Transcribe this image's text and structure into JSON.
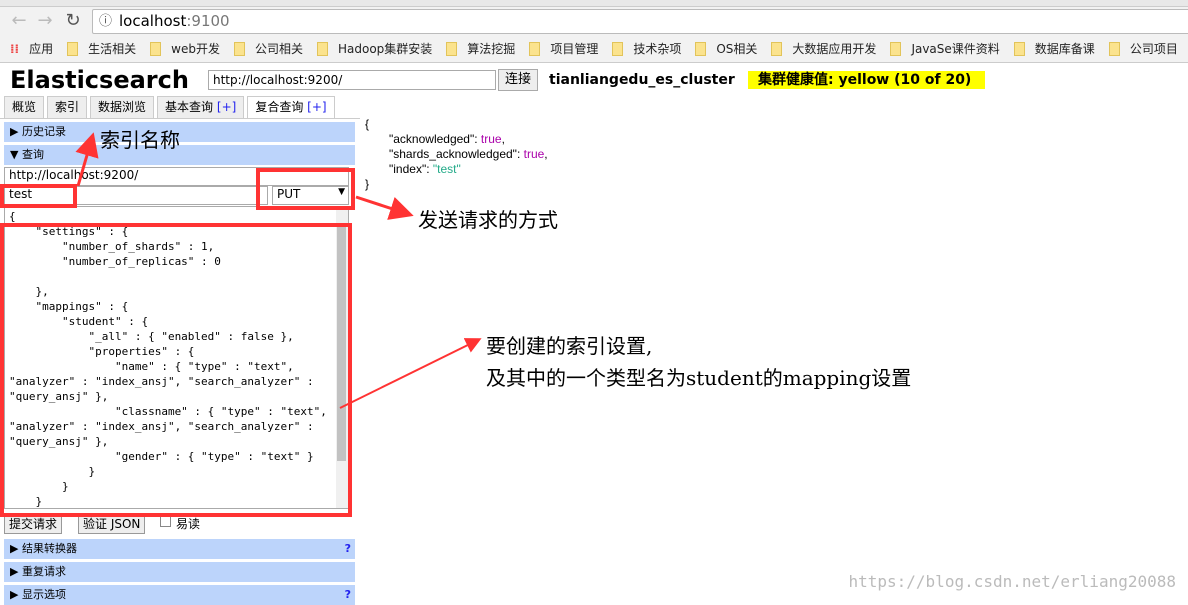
{
  "browser": {
    "url_host": "localhost",
    "url_port": ":9100",
    "bookmarks": [
      "应用",
      "生活相关",
      "web开发",
      "公司相关",
      "Hadoop集群安装",
      "算法挖掘",
      "项目管理",
      "技术杂项",
      "OS相关",
      "大数据应用开发",
      "JavaSe课件资料",
      "数据库备课",
      "公司项目"
    ]
  },
  "header": {
    "title": "Elasticsearch",
    "host": "http://localhost:9200/",
    "connect": "连接",
    "cluster": "tianliangedu_es_cluster",
    "health": "集群健康值: yellow (10 of 20)",
    "health_color": "#ffff00"
  },
  "tabs": [
    {
      "label": "概览"
    },
    {
      "label": "索引"
    },
    {
      "label": "数据浏览"
    },
    {
      "label": "基本查询",
      "plus": "[+]"
    },
    {
      "label": "复合查询",
      "plus": "[+]"
    }
  ],
  "left": {
    "history": "历史记录",
    "query": "查询",
    "url": "http://localhost:9200/",
    "index": "test",
    "method": "PUT",
    "body": "{\n    \"settings\" : {\n        \"number_of_shards\" : 1,\n        \"number_of_replicas\" : 0\n\n    },\n    \"mappings\" : {\n        \"student\" : {\n            \"_all\" : { \"enabled\" : false },\n            \"properties\" : {\n                \"name\" : { \"type\" : \"text\",\n\"analyzer\" : \"index_ansj\", \"search_analyzer\" :\n\"query_ansj\" },\n                \"classname\" : { \"type\" : \"text\",\n\"analyzer\" : \"index_ansj\", \"search_analyzer\" :\n\"query_ansj\" },\n                \"gender\" : { \"type\" : \"text\" }\n            }\n        }\n    }",
    "submit": "提交请求",
    "validate": "验证 JSON",
    "easy_read": "易读",
    "sections": [
      {
        "label": "结果转换器",
        "help": "?"
      },
      {
        "label": "重复请求",
        "help": ""
      },
      {
        "label": "显示选项",
        "help": "?"
      }
    ]
  },
  "response": {
    "open": "{",
    "close": "}",
    "rows": [
      {
        "key": "\"acknowledged\"",
        "value": "true",
        "type": "kw"
      },
      {
        "key": "\"shards_acknowledged\"",
        "value": "true",
        "type": "kw"
      },
      {
        "key": "\"index\"",
        "value": "\"test\"",
        "type": "str"
      }
    ]
  },
  "annotations": {
    "index_name": "索引名称",
    "method": "发送请求的方式",
    "settings_line1": "要创建的索引设置,",
    "settings_line2": "及其中的一个类型名为student的mapping设置",
    "annotation_color": "#ff3333"
  },
  "watermark": "https://blog.csdn.net/erliang20088"
}
